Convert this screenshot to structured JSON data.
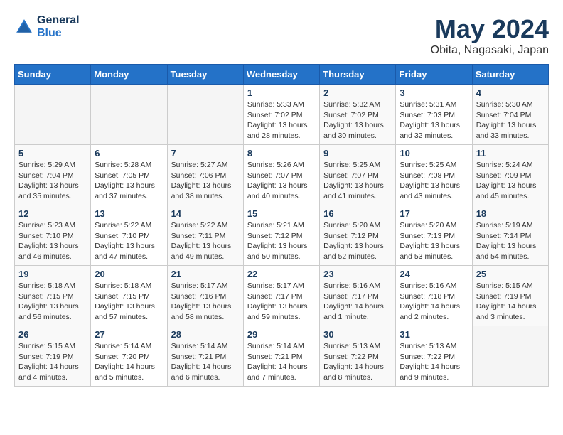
{
  "header": {
    "logo_line1": "General",
    "logo_line2": "Blue",
    "month_year": "May 2024",
    "location": "Obita, Nagasaki, Japan"
  },
  "days_of_week": [
    "Sunday",
    "Monday",
    "Tuesday",
    "Wednesday",
    "Thursday",
    "Friday",
    "Saturday"
  ],
  "weeks": [
    [
      {
        "day": "",
        "info": ""
      },
      {
        "day": "",
        "info": ""
      },
      {
        "day": "",
        "info": ""
      },
      {
        "day": "1",
        "info": "Sunrise: 5:33 AM\nSunset: 7:02 PM\nDaylight: 13 hours\nand 28 minutes."
      },
      {
        "day": "2",
        "info": "Sunrise: 5:32 AM\nSunset: 7:02 PM\nDaylight: 13 hours\nand 30 minutes."
      },
      {
        "day": "3",
        "info": "Sunrise: 5:31 AM\nSunset: 7:03 PM\nDaylight: 13 hours\nand 32 minutes."
      },
      {
        "day": "4",
        "info": "Sunrise: 5:30 AM\nSunset: 7:04 PM\nDaylight: 13 hours\nand 33 minutes."
      }
    ],
    [
      {
        "day": "5",
        "info": "Sunrise: 5:29 AM\nSunset: 7:04 PM\nDaylight: 13 hours\nand 35 minutes."
      },
      {
        "day": "6",
        "info": "Sunrise: 5:28 AM\nSunset: 7:05 PM\nDaylight: 13 hours\nand 37 minutes."
      },
      {
        "day": "7",
        "info": "Sunrise: 5:27 AM\nSunset: 7:06 PM\nDaylight: 13 hours\nand 38 minutes."
      },
      {
        "day": "8",
        "info": "Sunrise: 5:26 AM\nSunset: 7:07 PM\nDaylight: 13 hours\nand 40 minutes."
      },
      {
        "day": "9",
        "info": "Sunrise: 5:25 AM\nSunset: 7:07 PM\nDaylight: 13 hours\nand 41 minutes."
      },
      {
        "day": "10",
        "info": "Sunrise: 5:25 AM\nSunset: 7:08 PM\nDaylight: 13 hours\nand 43 minutes."
      },
      {
        "day": "11",
        "info": "Sunrise: 5:24 AM\nSunset: 7:09 PM\nDaylight: 13 hours\nand 45 minutes."
      }
    ],
    [
      {
        "day": "12",
        "info": "Sunrise: 5:23 AM\nSunset: 7:10 PM\nDaylight: 13 hours\nand 46 minutes."
      },
      {
        "day": "13",
        "info": "Sunrise: 5:22 AM\nSunset: 7:10 PM\nDaylight: 13 hours\nand 47 minutes."
      },
      {
        "day": "14",
        "info": "Sunrise: 5:22 AM\nSunset: 7:11 PM\nDaylight: 13 hours\nand 49 minutes."
      },
      {
        "day": "15",
        "info": "Sunrise: 5:21 AM\nSunset: 7:12 PM\nDaylight: 13 hours\nand 50 minutes."
      },
      {
        "day": "16",
        "info": "Sunrise: 5:20 AM\nSunset: 7:12 PM\nDaylight: 13 hours\nand 52 minutes."
      },
      {
        "day": "17",
        "info": "Sunrise: 5:20 AM\nSunset: 7:13 PM\nDaylight: 13 hours\nand 53 minutes."
      },
      {
        "day": "18",
        "info": "Sunrise: 5:19 AM\nSunset: 7:14 PM\nDaylight: 13 hours\nand 54 minutes."
      }
    ],
    [
      {
        "day": "19",
        "info": "Sunrise: 5:18 AM\nSunset: 7:15 PM\nDaylight: 13 hours\nand 56 minutes."
      },
      {
        "day": "20",
        "info": "Sunrise: 5:18 AM\nSunset: 7:15 PM\nDaylight: 13 hours\nand 57 minutes."
      },
      {
        "day": "21",
        "info": "Sunrise: 5:17 AM\nSunset: 7:16 PM\nDaylight: 13 hours\nand 58 minutes."
      },
      {
        "day": "22",
        "info": "Sunrise: 5:17 AM\nSunset: 7:17 PM\nDaylight: 13 hours\nand 59 minutes."
      },
      {
        "day": "23",
        "info": "Sunrise: 5:16 AM\nSunset: 7:17 PM\nDaylight: 14 hours\nand 1 minute."
      },
      {
        "day": "24",
        "info": "Sunrise: 5:16 AM\nSunset: 7:18 PM\nDaylight: 14 hours\nand 2 minutes."
      },
      {
        "day": "25",
        "info": "Sunrise: 5:15 AM\nSunset: 7:19 PM\nDaylight: 14 hours\nand 3 minutes."
      }
    ],
    [
      {
        "day": "26",
        "info": "Sunrise: 5:15 AM\nSunset: 7:19 PM\nDaylight: 14 hours\nand 4 minutes."
      },
      {
        "day": "27",
        "info": "Sunrise: 5:14 AM\nSunset: 7:20 PM\nDaylight: 14 hours\nand 5 minutes."
      },
      {
        "day": "28",
        "info": "Sunrise: 5:14 AM\nSunset: 7:21 PM\nDaylight: 14 hours\nand 6 minutes."
      },
      {
        "day": "29",
        "info": "Sunrise: 5:14 AM\nSunset: 7:21 PM\nDaylight: 14 hours\nand 7 minutes."
      },
      {
        "day": "30",
        "info": "Sunrise: 5:13 AM\nSunset: 7:22 PM\nDaylight: 14 hours\nand 8 minutes."
      },
      {
        "day": "31",
        "info": "Sunrise: 5:13 AM\nSunset: 7:22 PM\nDaylight: 14 hours\nand 9 minutes."
      },
      {
        "day": "",
        "info": ""
      }
    ]
  ]
}
